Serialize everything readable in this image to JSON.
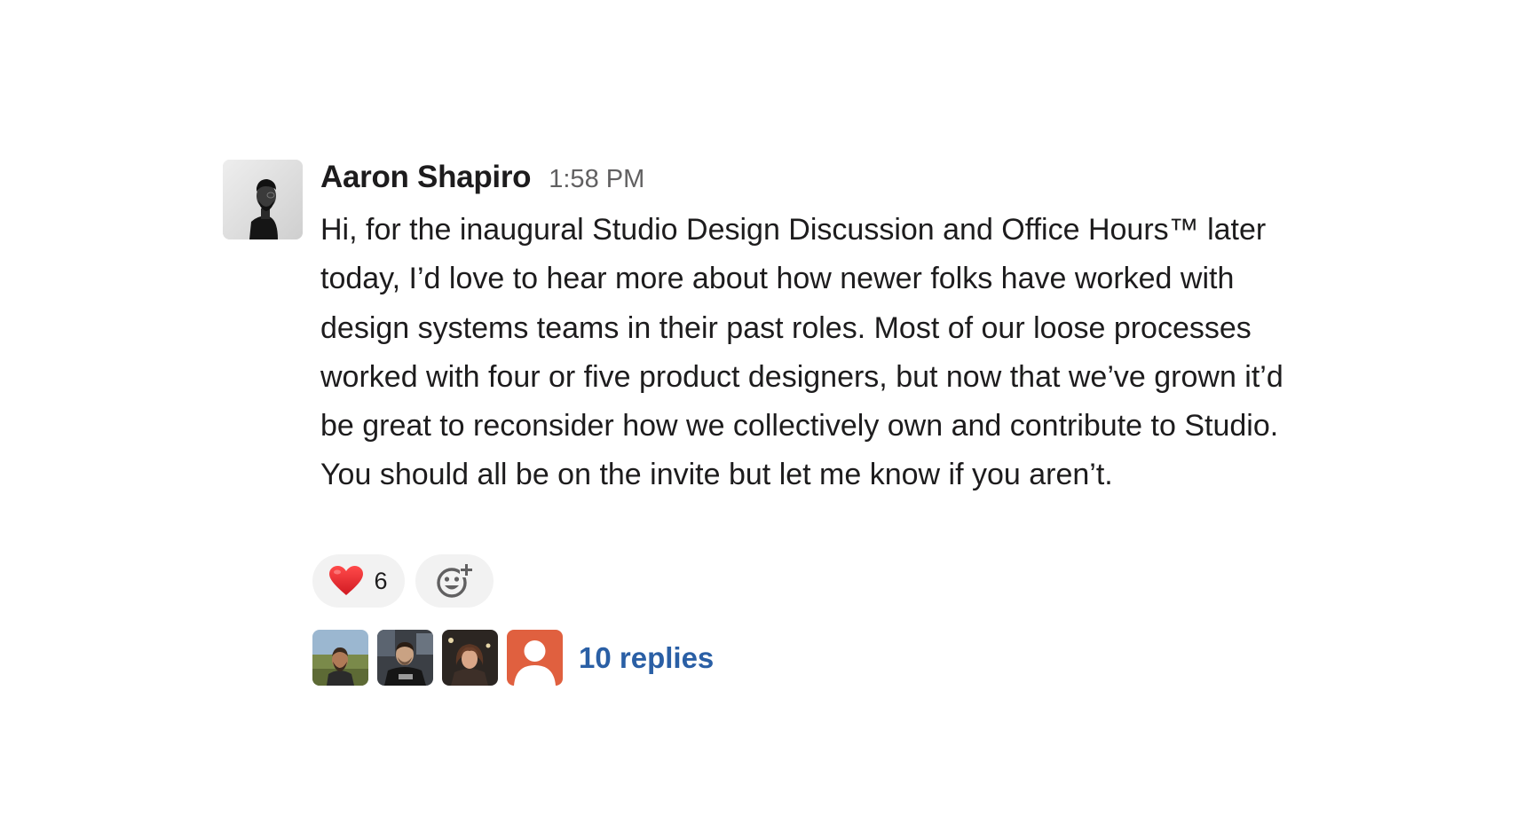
{
  "message": {
    "sender": "Aaron Shapiro",
    "timestamp": "1:58 PM",
    "paragraphs": [
      "Hi, for the inaugural Studio Design Discussion and Office Hours™ later today, I’d love to hear more about how newer folks have worked with design systems teams in their past roles. Most of our loose processes worked with four or five product designers, but now that we’ve grown it’d be great to reconsider how we collectively own and contribute to Studio.",
      "You should all be on the invite but let me know if you aren’t."
    ]
  },
  "reactions": {
    "heart": {
      "icon": "heart-emoji",
      "count": "6",
      "color": "#e0242f"
    },
    "add_reaction_icon": "add-reaction-icon"
  },
  "thread": {
    "participant_avatars": [
      "avatar-photo-outdoors",
      "avatar-photo-dark-shirt",
      "avatar-photo-woman",
      "avatar-placeholder"
    ],
    "replies_label": "10 replies",
    "link_color": "#2a5fa5"
  }
}
